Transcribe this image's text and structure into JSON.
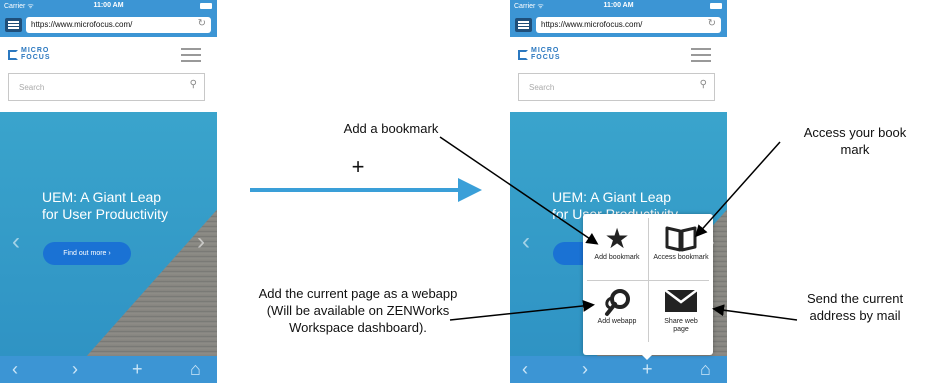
{
  "phone_left": {
    "status": {
      "carrier": "Carrier ᯤ",
      "time": "11:00 AM"
    },
    "url": "https://www.microfocus.com/",
    "logo": {
      "line1": "MICRO",
      "line2": "FOCUS"
    },
    "search_placeholder": "Search",
    "hero": {
      "title_line1": "UEM: A Giant Leap",
      "title_line2": "for User Productivity",
      "cta": "Find out more ›"
    },
    "toolbar": {
      "back": "‹",
      "forward": "›",
      "add": "+",
      "home": "⌂"
    }
  },
  "phone_right": {
    "status": {
      "carrier": "Carrier ᯤ",
      "time": "11:00 AM"
    },
    "url": "https://www.microfocus.com/",
    "logo": {
      "line1": "MICRO",
      "line2": "FOCUS"
    },
    "search_placeholder": "Search",
    "hero": {
      "title_line1": "UEM: A Giant Leap",
      "title_line2": "for User Productivity",
      "cta": "Fi"
    },
    "toolbar": {
      "back": "‹",
      "forward": "›",
      "add": "+",
      "home": "⌂"
    }
  },
  "popup": {
    "add_bookmark": "Add bookmark",
    "access_bookmark": "Access bookmark",
    "add_webapp": "Add webapp",
    "share_web_page": "Share web page"
  },
  "annotations": {
    "plus_symbol": "+",
    "add_bookmark_label": "Add a bookmark",
    "access_bookmark_label": "Access your book mark",
    "add_webapp_label": "Add the current page as a webapp (Will be available on ZENWorks Workspace dashboard).",
    "send_mail_label": "Send the current address by mail"
  },
  "colors": {
    "bar": "#3c95d4",
    "hero": "#3aa4cc",
    "cta": "#1a72d4",
    "arrow": "#3a9fd8"
  }
}
